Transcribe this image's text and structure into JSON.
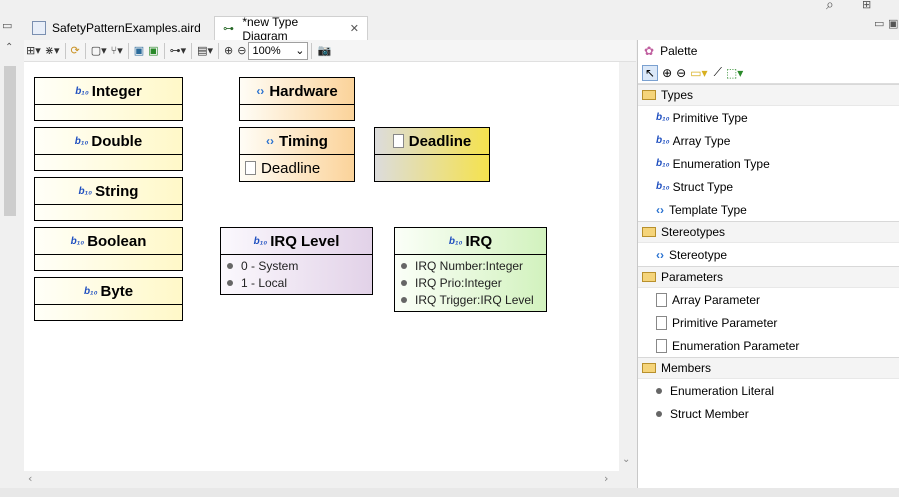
{
  "tabs": [
    {
      "label": "SafetyPatternExamples.aird",
      "active": false
    },
    {
      "label": "*new Type Diagram",
      "active": true
    }
  ],
  "toolbar": {
    "zoom": "100%"
  },
  "nodes": {
    "integer": {
      "name": "Integer"
    },
    "double": {
      "name": "Double"
    },
    "string": {
      "name": "String"
    },
    "boolean": {
      "name": "Boolean"
    },
    "byte": {
      "name": "Byte"
    },
    "hardware": {
      "name": "Hardware"
    },
    "timing": {
      "name": "Timing",
      "param": "Deadline"
    },
    "deadline": {
      "name": "Deadline"
    },
    "irq_level": {
      "name": "IRQ Level",
      "literals": [
        "0 - System",
        "1 - Local"
      ]
    },
    "irq": {
      "name": "IRQ",
      "members": [
        "IRQ Number:Integer",
        "IRQ Prio:Integer",
        "IRQ Trigger:IRQ Level"
      ]
    }
  },
  "palette": {
    "title": "Palette",
    "groups": [
      {
        "label": "Types",
        "items": [
          "Primitive Type",
          "Array Type",
          "Enumeration Type",
          "Struct Type",
          "Template Type"
        ]
      },
      {
        "label": "Stereotypes",
        "items": [
          "Stereotype"
        ]
      },
      {
        "label": "Parameters",
        "items": [
          "Array Parameter",
          "Primitive Parameter",
          "Enumeration Parameter"
        ]
      },
      {
        "label": "Members",
        "items": [
          "Enumeration Literal",
          "Struct Member"
        ]
      }
    ]
  },
  "colors": {
    "datatype": "#fff8c8",
    "hardware": "#fbd39a",
    "deadline": "#f5e24e",
    "enumeration": "#e2d2e8",
    "struct": "#d2f2be"
  }
}
